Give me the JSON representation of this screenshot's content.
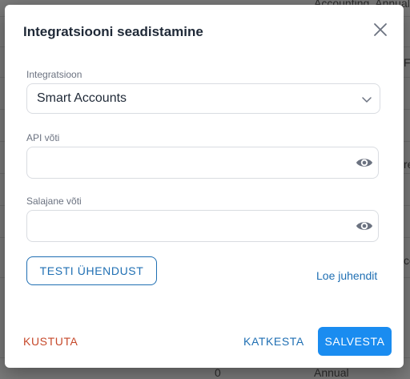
{
  "background": {
    "fragments": [
      "Accounting, Annual",
      "F",
      "re",
      "co",
      "Annual",
      "0"
    ]
  },
  "dialog": {
    "title": "Integratsiooni seadistamine",
    "close_icon": "close-icon",
    "integration": {
      "label": "Integratsioon",
      "selected": "Smart Accounts",
      "icon": "chevron-down-icon"
    },
    "api_key": {
      "label": "API võti",
      "value": "",
      "icon": "eye-icon"
    },
    "secret_key": {
      "label": "Salajane võti",
      "value": "",
      "icon": "eye-icon"
    },
    "test_button": "TESTI ÜHENDUST",
    "instructions_link": "Loe juhendit",
    "delete_button": "KUSTUTA",
    "cancel_button": "KATKESTA",
    "save_button": "SALVESTA"
  },
  "colors": {
    "primary": "#1a8cf0",
    "link": "#1f6fb3",
    "danger": "#c6482a"
  }
}
